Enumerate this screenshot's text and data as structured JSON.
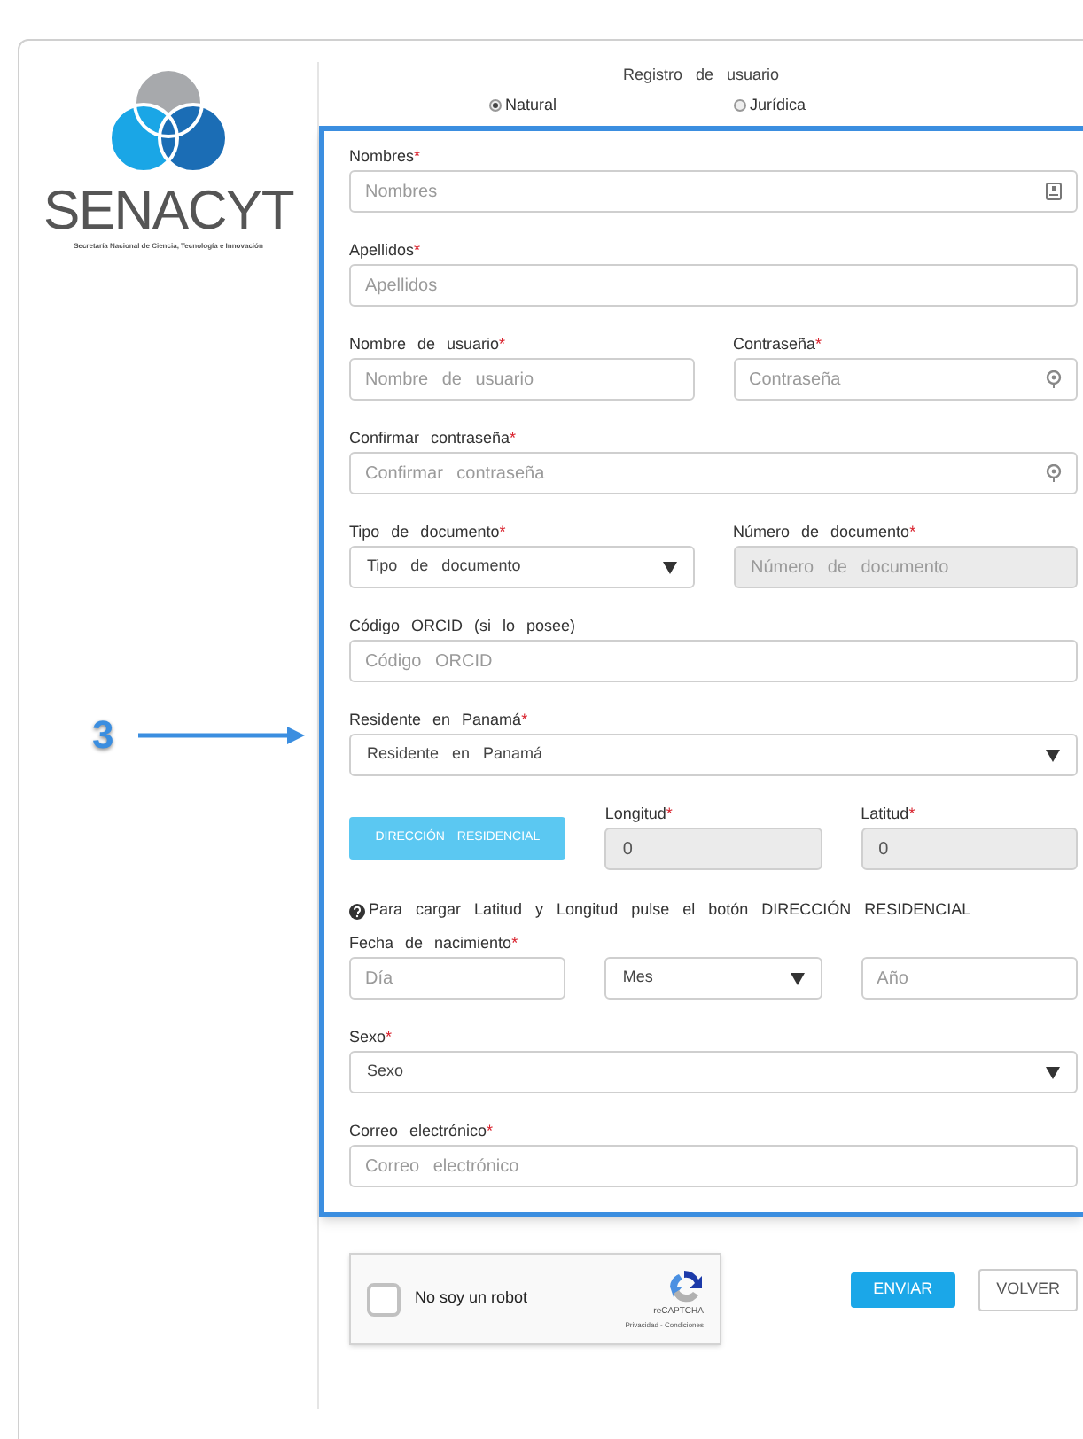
{
  "logo": {
    "name": "SENACYT",
    "subtitle": "Secretaría Nacional de Ciencia, Tecnología e Innovación"
  },
  "form_title": "Registro de usuario",
  "person_type": [
    {
      "label": "Natural",
      "selected": true
    },
    {
      "label": "Jurídica",
      "selected": false
    }
  ],
  "rows": [
    {
      "fields": [
        {
          "kind": "text",
          "label": "Nombres",
          "required_mark": "*",
          "placeholder": "Nombres",
          "contact_icon": true
        }
      ]
    },
    {
      "fields": [
        {
          "kind": "text",
          "label": "Apellidos",
          "required_mark": "*",
          "placeholder": "Apellidos"
        }
      ]
    },
    {
      "fields": [
        {
          "kind": "text",
          "label": "Nombre de usuario",
          "required_mark": "*",
          "placeholder": "Nombre de usuario"
        },
        {
          "kind": "password",
          "label": "Contraseña",
          "required_mark": "*",
          "placeholder": "Contraseña"
        }
      ]
    },
    {
      "fields": [
        {
          "kind": "password",
          "label": "Confirmar contraseña",
          "required_mark": "*",
          "placeholder": "Confirmar contraseña"
        }
      ]
    },
    {
      "fields": [
        {
          "kind": "select",
          "label": "Tipo de documento",
          "required_mark": "*",
          "value": "Tipo de documento"
        },
        {
          "kind": "readonly",
          "label": "Número de documento",
          "required_mark": "*",
          "placeholder": "Número de documento"
        }
      ]
    },
    {
      "fields": [
        {
          "kind": "text",
          "label": "Código ORCID (si lo posee)",
          "placeholder": "Código ORCID"
        }
      ]
    },
    {
      "fields": [
        {
          "kind": "select",
          "label": "Residente en Panamá",
          "required_mark": "*",
          "value": "Residente en Panamá"
        }
      ]
    },
    {
      "fields": [
        {
          "kind": "button",
          "label": "DIRECCIÓN RESIDENCIAL"
        },
        {
          "kind": "readonly",
          "label": "Longitud",
          "required_mark": "*",
          "value": "0"
        },
        {
          "kind": "readonly",
          "label": "Latitud",
          "required_mark": "*",
          "value": "0"
        }
      ]
    },
    {
      "help": "Para cargar Latitud y Longitud pulse el botón DIRECCIÓN RESIDENCIAL"
    },
    {
      "fields": [
        {
          "kind": "text",
          "label": "Fecha de nacimiento",
          "required_mark": "*",
          "placeholder": "Día"
        },
        {
          "kind": "select",
          "value": "Mes"
        },
        {
          "kind": "text",
          "placeholder": "Año"
        }
      ]
    },
    {
      "fields": [
        {
          "kind": "select",
          "label": "Sexo",
          "required_mark": "*",
          "value": "Sexo"
        }
      ]
    },
    {
      "fields": [
        {
          "kind": "text",
          "label": "Correo electrónico",
          "required_mark": "*",
          "placeholder": "Correo electrónico"
        }
      ]
    }
  ],
  "captcha": {
    "label": "No soy un robot",
    "checked": false,
    "brand": "reCAPTCHA",
    "links": "Privacidad - Condiciones"
  },
  "buttons": [
    {
      "label": "ENVIAR",
      "kind": "primary"
    },
    {
      "label": "VOLVER",
      "kind": "secondary"
    }
  ],
  "annotation": {
    "number": "3"
  }
}
